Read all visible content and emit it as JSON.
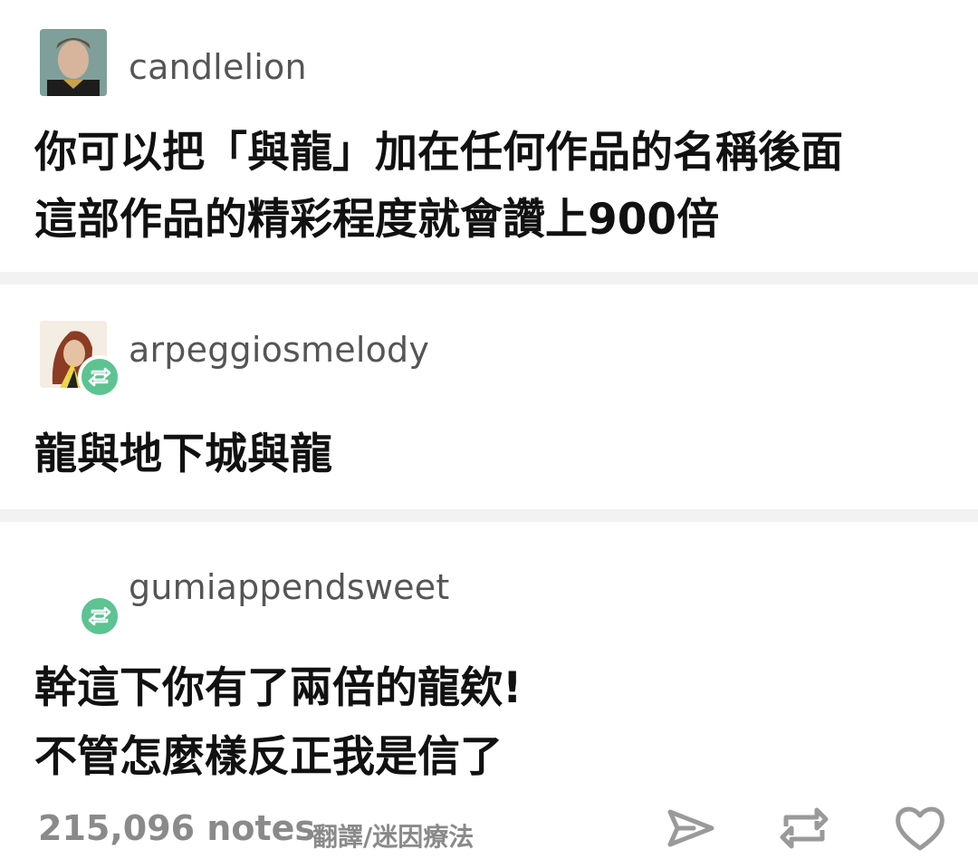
{
  "posts": [
    {
      "username": "candlelion",
      "lines": [
        "你可以把「與龍」加在任何作品的名稱後面",
        "這部作品的精彩程度就會讚上900倍"
      ]
    },
    {
      "username": "arpeggiosmelody",
      "lines": [
        "龍與地下城與龍"
      ]
    },
    {
      "username": "gumiappendsweet",
      "lines": [
        "幹這下你有了兩倍的龍欸!",
        "不管怎麼樣反正我是信了"
      ]
    }
  ],
  "footer": {
    "notes": "215,096 notes",
    "credit": "翻譯/迷因療法"
  },
  "colors": {
    "reblog_green": "#5cc391",
    "muted_text": "#8a8a8a",
    "separator": "#f2f2f2"
  }
}
